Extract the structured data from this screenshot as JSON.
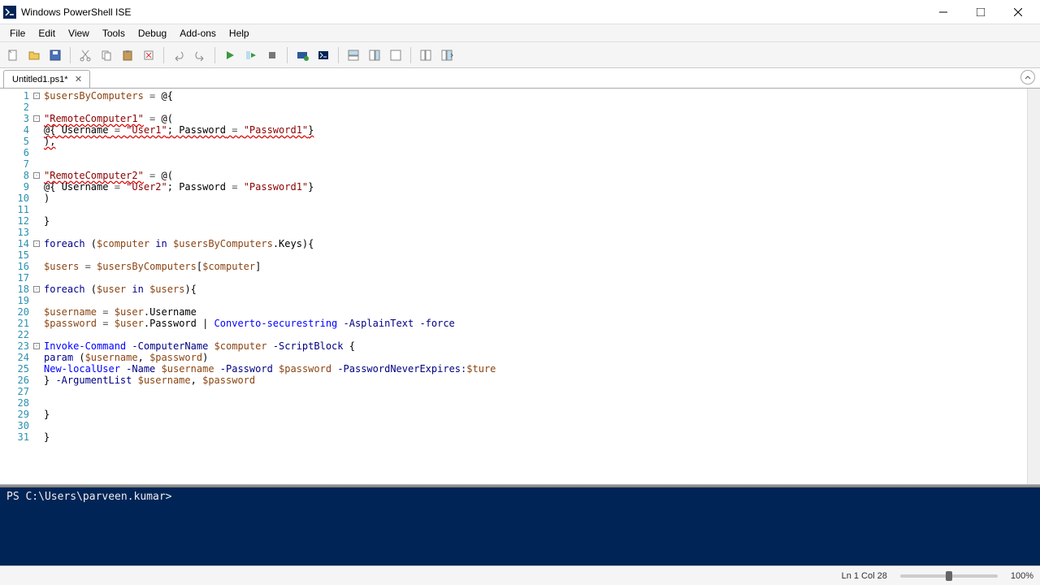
{
  "window": {
    "title": "Windows PowerShell ISE"
  },
  "menu": {
    "items": [
      "File",
      "Edit",
      "View",
      "Tools",
      "Debug",
      "Add-ons",
      "Help"
    ]
  },
  "tab": {
    "label": "Untitled1.ps1*"
  },
  "code": {
    "lines": [
      [
        {
          "t": "$usersByComputers",
          "c": "tok-var"
        },
        {
          "t": " = ",
          "c": "tok-op"
        },
        {
          "t": "@{",
          "c": ""
        }
      ],
      [],
      [
        {
          "t": "\"RemoteComputer1\"",
          "c": "tok-str err-underline"
        },
        {
          "t": " = ",
          "c": "tok-op"
        },
        {
          "t": "@(",
          "c": ""
        }
      ],
      [
        {
          "t": "@{ ",
          "c": "err-underline"
        },
        {
          "t": "Username",
          "c": "err-underline"
        },
        {
          "t": " = ",
          "c": "tok-op err-underline"
        },
        {
          "t": "\"User1\"",
          "c": "tok-str err-underline"
        },
        {
          "t": "; ",
          "c": "err-underline"
        },
        {
          "t": "Password",
          "c": "err-underline"
        },
        {
          "t": " = ",
          "c": "tok-op err-underline"
        },
        {
          "t": "\"Password1\"",
          "c": "tok-str err-underline"
        },
        {
          "t": "}",
          "c": "err-underline"
        }
      ],
      [
        {
          "t": "),",
          "c": "err-underline"
        }
      ],
      [],
      [],
      [
        {
          "t": "\"RemoteComputer2\"",
          "c": "tok-str err-underline"
        },
        {
          "t": " = ",
          "c": "tok-op"
        },
        {
          "t": "@(",
          "c": ""
        }
      ],
      [
        {
          "t": "@{ ",
          "c": ""
        },
        {
          "t": "Username",
          "c": ""
        },
        {
          "t": " = ",
          "c": "tok-op"
        },
        {
          "t": "\"User2\"",
          "c": "tok-str"
        },
        {
          "t": "; ",
          "c": ""
        },
        {
          "t": "Password",
          "c": ""
        },
        {
          "t": " = ",
          "c": "tok-op"
        },
        {
          "t": "\"Password1\"",
          "c": "tok-str"
        },
        {
          "t": "}",
          "c": ""
        }
      ],
      [
        {
          "t": ")",
          "c": ""
        }
      ],
      [],
      [
        {
          "t": "}",
          "c": ""
        }
      ],
      [],
      [
        {
          "t": "foreach",
          "c": "tok-kw"
        },
        {
          "t": " (",
          "c": ""
        },
        {
          "t": "$computer",
          "c": "tok-var"
        },
        {
          "t": " ",
          "c": ""
        },
        {
          "t": "in",
          "c": "tok-kw"
        },
        {
          "t": " ",
          "c": ""
        },
        {
          "t": "$usersByComputers",
          "c": "tok-var"
        },
        {
          "t": ".Keys){",
          "c": ""
        }
      ],
      [],
      [
        {
          "t": "$users",
          "c": "tok-var"
        },
        {
          "t": " = ",
          "c": "tok-op"
        },
        {
          "t": "$usersByComputers",
          "c": "tok-var"
        },
        {
          "t": "[",
          "c": ""
        },
        {
          "t": "$computer",
          "c": "tok-var"
        },
        {
          "t": "]",
          "c": ""
        }
      ],
      [],
      [
        {
          "t": "foreach",
          "c": "tok-kw"
        },
        {
          "t": " (",
          "c": ""
        },
        {
          "t": "$user",
          "c": "tok-var"
        },
        {
          "t": " ",
          "c": ""
        },
        {
          "t": "in",
          "c": "tok-kw"
        },
        {
          "t": " ",
          "c": ""
        },
        {
          "t": "$users",
          "c": "tok-var"
        },
        {
          "t": "){",
          "c": ""
        }
      ],
      [],
      [
        {
          "t": "$username",
          "c": "tok-var"
        },
        {
          "t": " = ",
          "c": "tok-op"
        },
        {
          "t": "$user",
          "c": "tok-var"
        },
        {
          "t": ".Username",
          "c": ""
        }
      ],
      [
        {
          "t": "$password",
          "c": "tok-var"
        },
        {
          "t": " = ",
          "c": "tok-op"
        },
        {
          "t": "$user",
          "c": "tok-var"
        },
        {
          "t": ".Password | ",
          "c": ""
        },
        {
          "t": "Converto-securestring",
          "c": "tok-cmd"
        },
        {
          "t": " ",
          "c": ""
        },
        {
          "t": "-AsplainText",
          "c": "tok-param"
        },
        {
          "t": " ",
          "c": ""
        },
        {
          "t": "-force",
          "c": "tok-param"
        }
      ],
      [],
      [
        {
          "t": "Invoke-Command",
          "c": "tok-cmd"
        },
        {
          "t": " ",
          "c": ""
        },
        {
          "t": "-ComputerName",
          "c": "tok-param"
        },
        {
          "t": " ",
          "c": ""
        },
        {
          "t": "$computer",
          "c": "tok-var"
        },
        {
          "t": " ",
          "c": ""
        },
        {
          "t": "-ScriptBlock",
          "c": "tok-param"
        },
        {
          "t": " {",
          "c": ""
        }
      ],
      [
        {
          "t": "param",
          "c": "tok-kw"
        },
        {
          "t": " (",
          "c": ""
        },
        {
          "t": "$username",
          "c": "tok-var"
        },
        {
          "t": ", ",
          "c": ""
        },
        {
          "t": "$password",
          "c": "tok-var"
        },
        {
          "t": ")",
          "c": ""
        }
      ],
      [
        {
          "t": "New-localUser",
          "c": "tok-cmd"
        },
        {
          "t": " ",
          "c": ""
        },
        {
          "t": "-Name",
          "c": "tok-param"
        },
        {
          "t": " ",
          "c": ""
        },
        {
          "t": "$username",
          "c": "tok-var"
        },
        {
          "t": " ",
          "c": ""
        },
        {
          "t": "-Password",
          "c": "tok-param"
        },
        {
          "t": " ",
          "c": ""
        },
        {
          "t": "$password",
          "c": "tok-var"
        },
        {
          "t": " ",
          "c": ""
        },
        {
          "t": "-PasswordNeverExpires:",
          "c": "tok-param"
        },
        {
          "t": "$ture",
          "c": "tok-var"
        }
      ],
      [
        {
          "t": "} ",
          "c": ""
        },
        {
          "t": "-ArgumentList",
          "c": "tok-param"
        },
        {
          "t": " ",
          "c": ""
        },
        {
          "t": "$username",
          "c": "tok-var"
        },
        {
          "t": ", ",
          "c": ""
        },
        {
          "t": "$password",
          "c": "tok-var"
        }
      ],
      [],
      [],
      [
        {
          "t": "}",
          "c": ""
        }
      ],
      [],
      [
        {
          "t": "}",
          "c": ""
        }
      ]
    ],
    "fold_lines": [
      1,
      3,
      8,
      14,
      18,
      23
    ],
    "total_lines": 31
  },
  "console": {
    "prompt": "PS C:\\Users\\parveen.kumar> "
  },
  "status": {
    "position": "Ln 1  Col 28",
    "zoom": "100%"
  }
}
